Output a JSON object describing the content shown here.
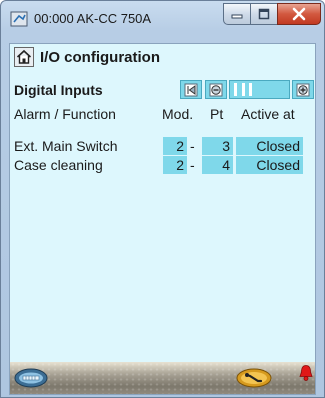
{
  "window": {
    "title": "00:000 AK-CC 750A",
    "controls": {
      "minimize": "minimize-icon",
      "maximize": "maximize-icon",
      "close": "close-icon"
    }
  },
  "header": {
    "title": "I/O configuration",
    "home_icon": "home-icon"
  },
  "section": {
    "title": "Digital Inputs",
    "nav": [
      "first-page-icon",
      "previous-page-icon",
      "next-page-icon"
    ]
  },
  "table": {
    "columns": {
      "function": "Alarm / Function",
      "module": "Mod.",
      "point": "Pt",
      "active_at": "Active at"
    },
    "rows": [
      {
        "function": "Ext. Main Switch",
        "module": "2",
        "separator": "-",
        "point": "3",
        "active_at": "Closed"
      },
      {
        "function": "Case cleaning",
        "module": "2",
        "separator": "-",
        "point": "4",
        "active_at": "Closed"
      }
    ]
  },
  "footer": {
    "icons": [
      "keyboard-icon",
      "wrench-icon",
      "alarm-bell-icon"
    ]
  },
  "colors": {
    "client_bg": "#ddf7fd",
    "cell_bg": "#7fd8ea",
    "alarm": "#e01818"
  }
}
